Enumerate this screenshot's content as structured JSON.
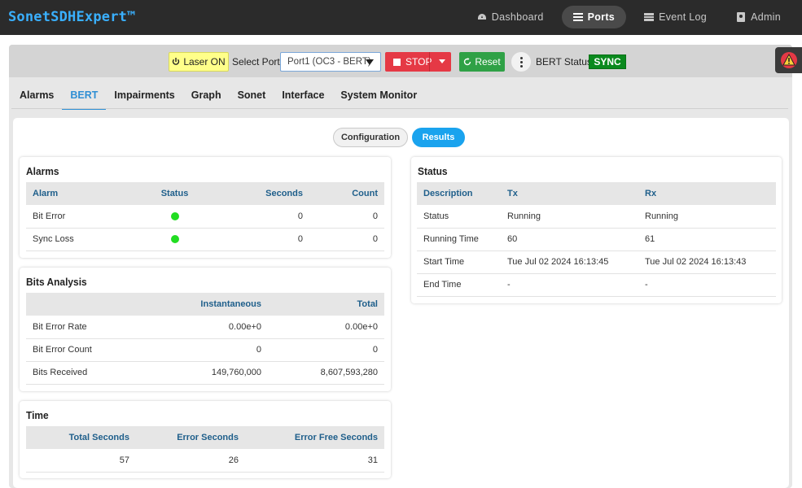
{
  "app": {
    "title": "SonetSDHExpert™",
    "nav": [
      {
        "label": "Dashboard",
        "icon": "dashboard-icon",
        "active": false
      },
      {
        "label": "Ports",
        "icon": "list-icon",
        "active": true
      },
      {
        "label": "Event Log",
        "icon": "log-icon",
        "active": false
      },
      {
        "label": "Admin",
        "icon": "user-icon",
        "active": false
      }
    ]
  },
  "toolbar": {
    "laser_label": "Laser ON",
    "select_port_label": "Select Port",
    "port_value": "Port1 (OC3 - BERT)",
    "stop_label": "STOP",
    "reset_label": "Reset",
    "bert_status_label": "BERT Status",
    "bert_status_value": "SYNC"
  },
  "tabs": [
    "Alarms",
    "BERT",
    "Impairments",
    "Graph",
    "Sonet",
    "Interface",
    "System Monitor"
  ],
  "active_tab": "BERT",
  "segments": {
    "config": "Configuration",
    "results": "Results"
  },
  "alarms": {
    "title": "Alarms",
    "headers": [
      "Alarm",
      "Status",
      "Seconds",
      "Count"
    ],
    "rows": [
      {
        "alarm": "Bit Error",
        "seconds": "0",
        "count": "0"
      },
      {
        "alarm": "Sync Loss",
        "seconds": "0",
        "count": "0"
      }
    ]
  },
  "bits": {
    "title": "Bits Analysis",
    "headers": [
      "",
      "Instantaneous",
      "Total"
    ],
    "rows": [
      {
        "name": "Bit Error Rate",
        "inst": "0.00e+0",
        "total": "0.00e+0"
      },
      {
        "name": "Bit Error Count",
        "inst": "0",
        "total": "0"
      },
      {
        "name": "Bits Received",
        "inst": "149,760,000",
        "total": "8,607,593,280"
      }
    ]
  },
  "time": {
    "title": "Time",
    "headers": [
      "Total Seconds",
      "Error Seconds",
      "Error Free Seconds"
    ],
    "values": [
      "57",
      "26",
      "31"
    ]
  },
  "status": {
    "title": "Status",
    "headers": [
      "Description",
      "Tx",
      "Rx"
    ],
    "rows": [
      {
        "desc": "Status",
        "tx": "Running",
        "rx": "Running"
      },
      {
        "desc": "Running Time",
        "tx": "60",
        "rx": "61"
      },
      {
        "desc": "Start Time",
        "tx": "Tue Jul 02 2024 16:13:45",
        "rx": "Tue Jul 02 2024 16:13:43"
      },
      {
        "desc": "End Time",
        "tx": "-",
        "rx": "-"
      }
    ]
  },
  "colors": {
    "accent": "#2f8fd4",
    "sync": "#0a8a1e",
    "stop": "#e53945",
    "reset": "#2fa146",
    "laser": "#ffff8a",
    "status_ok": "#22dd22"
  }
}
